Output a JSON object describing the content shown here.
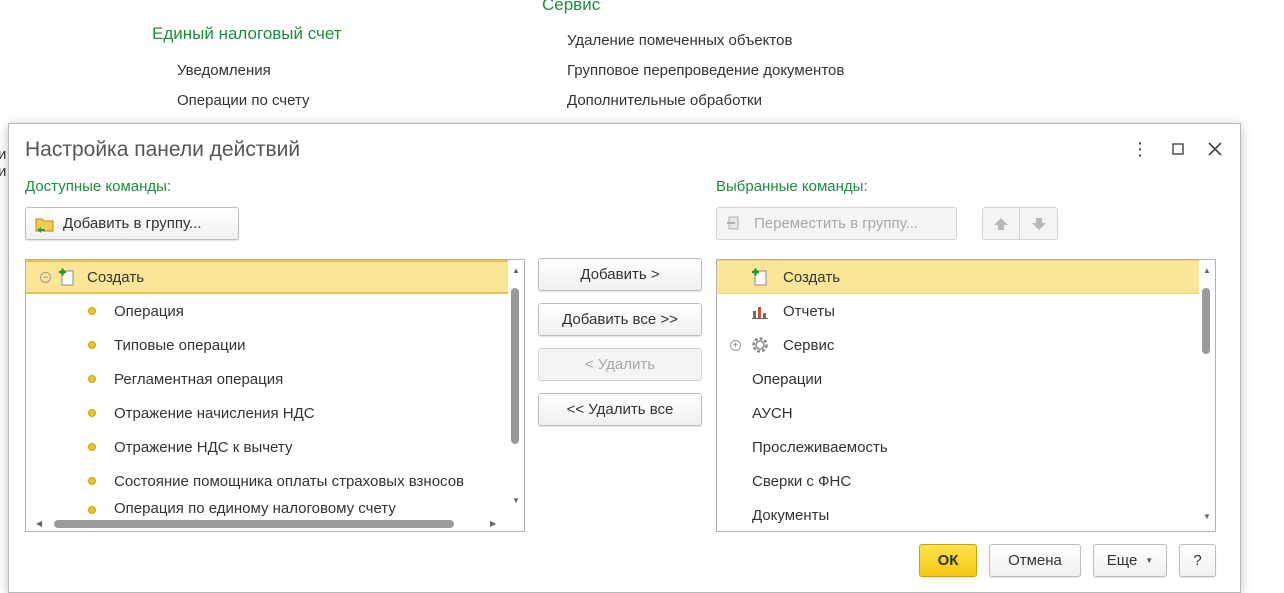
{
  "background": {
    "left_group": {
      "title": "Единый налоговый счет",
      "links": [
        "Уведомления",
        "Операции по счету"
      ]
    },
    "right_group": {
      "title": "Сервис",
      "links": [
        "Удаление помеченных объектов",
        "Групповое перепроведение документов",
        "Дополнительные обработки"
      ]
    },
    "edge_fragments": [
      "и",
      "и"
    ]
  },
  "dialog": {
    "title": "Настройка панели действий",
    "window_buttons": {
      "more": "⋮",
      "maximize": "☐",
      "close": "✕"
    }
  },
  "available": {
    "label": "Доступные команды:",
    "add_to_group_button": "Добавить в группу...",
    "tree": {
      "root": "Создать",
      "items": [
        "Операция",
        "Типовые операции",
        "Регламентная операция",
        "Отражение начисления НДС",
        "Отражение НДС к вычету",
        "Состояние помощника оплаты страховых взносов",
        "Операция по единому налоговому счету"
      ]
    }
  },
  "middle_buttons": {
    "add": "Добавить >",
    "add_all": "Добавить все >>",
    "remove": "< Удалить",
    "remove_all": "<< Удалить все"
  },
  "selected": {
    "label": "Выбранные команды:",
    "move_to_group_button": "Переместить в группу...",
    "items": [
      {
        "label": "Создать",
        "icon": "create-icon",
        "selected": true
      },
      {
        "label": "Отчеты",
        "icon": "reports-icon"
      },
      {
        "label": "Сервис",
        "icon": "gear-icon",
        "expandable": true
      },
      {
        "label": "Операции"
      },
      {
        "label": "АУСН"
      },
      {
        "label": "Прослеживаемость"
      },
      {
        "label": "Сверки с ФНС"
      },
      {
        "label": "Документы"
      }
    ]
  },
  "footer": {
    "ok": "ОК",
    "cancel": "Отмена",
    "more": "Еще",
    "help": "?"
  },
  "colors": {
    "accent_green": "#1a8f3c",
    "selection": "#fbe597",
    "ok_button": "#f2c813"
  }
}
